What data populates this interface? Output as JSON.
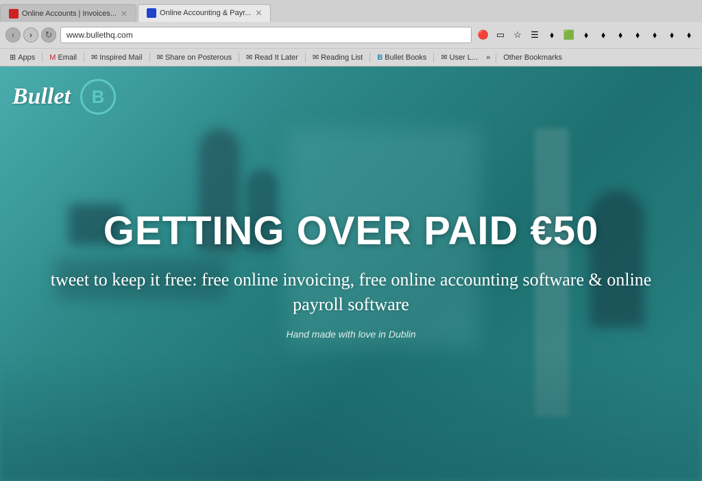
{
  "browser": {
    "tabs": [
      {
        "label": "Online Accounts | Invoices...",
        "active": false,
        "favicon": "red"
      },
      {
        "label": "Online Accounting & Payr...",
        "active": true,
        "favicon": "blue"
      }
    ],
    "address": "www.bullethq.com",
    "nav": {
      "back": "‹",
      "forward": "›",
      "reload": "↻"
    },
    "bookmarks": [
      {
        "label": "Apps",
        "icon": "⊞"
      },
      {
        "label": "Email",
        "icon": "M"
      },
      {
        "label": "Inspired Mail",
        "icon": "✉"
      },
      {
        "label": "Share on Posterous",
        "icon": "✉"
      },
      {
        "label": "Read It Later",
        "icon": "✉"
      },
      {
        "label": "Reading List",
        "icon": "✉"
      },
      {
        "label": "Bullet Books",
        "icon": "B"
      },
      {
        "label": "User L...",
        "icon": "✉"
      }
    ],
    "more_bookmarks": "»",
    "other_bookmarks": "Other Bookmarks"
  },
  "website": {
    "logo_text": "Bullet",
    "logo_b": "B",
    "headline": "GETTING OVER PAID €50",
    "subheadline": "tweet to keep it free: free online invoicing, free online accounting software & online payroll software",
    "tagline": "Hand made with love in Dublin"
  }
}
